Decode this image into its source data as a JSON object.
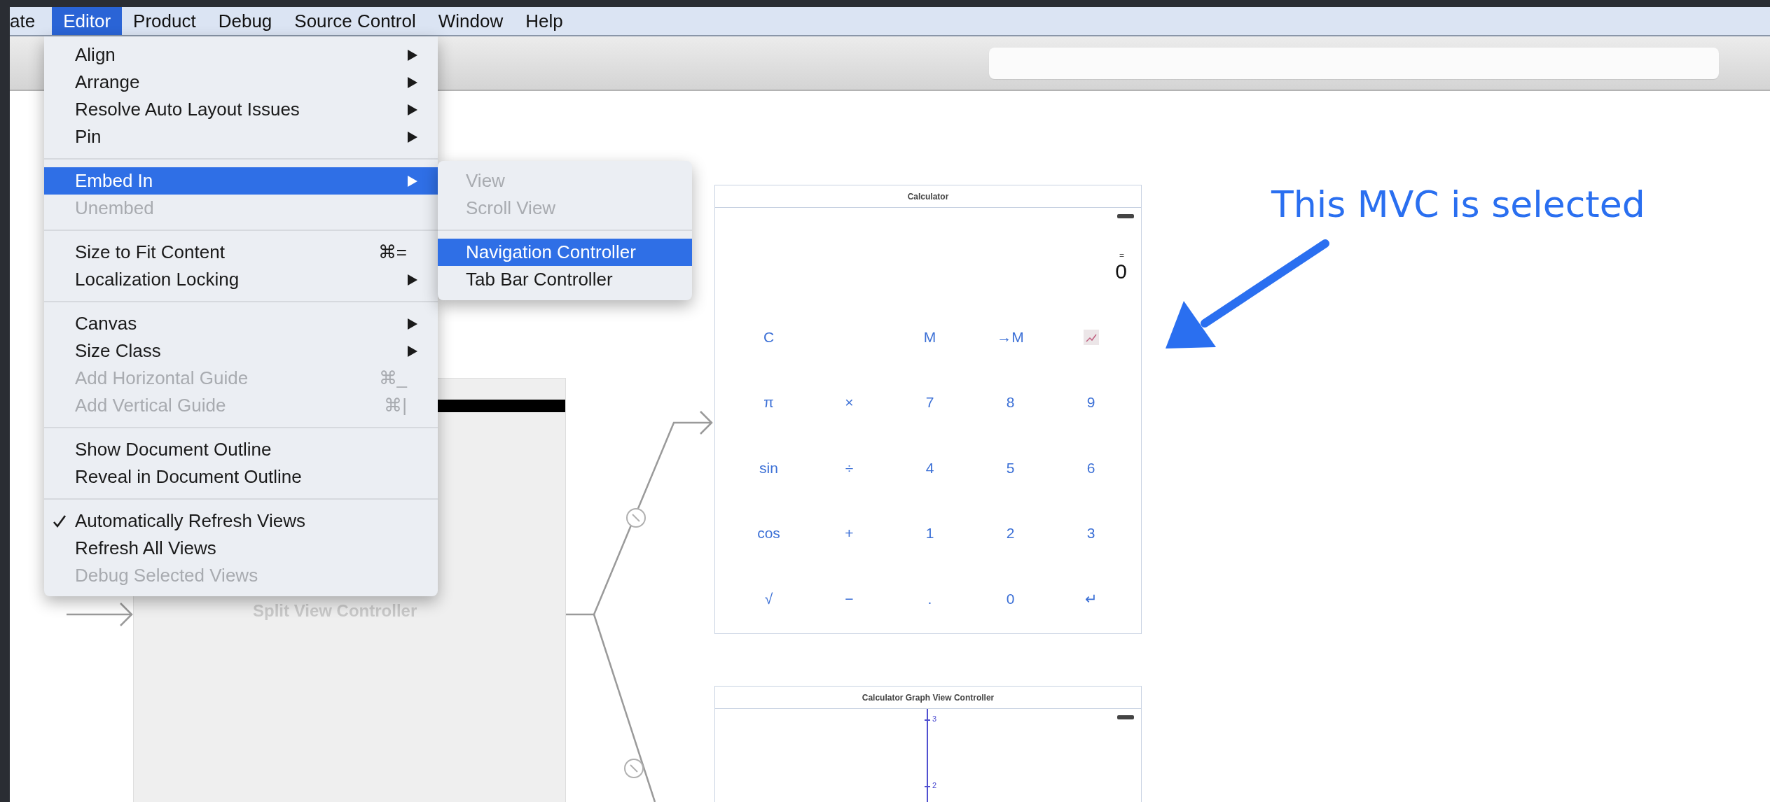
{
  "menu_bar": {
    "items": [
      {
        "label": "ate",
        "selected": false
      },
      {
        "label": "Editor",
        "selected": true
      },
      {
        "label": "Product",
        "selected": false
      },
      {
        "label": "Debug",
        "selected": false
      },
      {
        "label": "Source Control",
        "selected": false
      },
      {
        "label": "Window",
        "selected": false
      },
      {
        "label": "Help",
        "selected": false
      }
    ]
  },
  "editor_menu": {
    "sections": [
      {
        "items": [
          {
            "label": "Align",
            "submenu": true,
            "disabled": false,
            "selected": false,
            "checked": false
          },
          {
            "label": "Arrange",
            "submenu": true,
            "disabled": false,
            "selected": false,
            "checked": false
          },
          {
            "label": "Resolve Auto Layout Issues",
            "submenu": true,
            "disabled": false,
            "selected": false,
            "checked": false
          },
          {
            "label": "Pin",
            "submenu": true,
            "disabled": false,
            "selected": false,
            "checked": false
          }
        ]
      },
      {
        "items": [
          {
            "label": "Embed In",
            "submenu": true,
            "disabled": false,
            "selected": true,
            "checked": false
          },
          {
            "label": "Unembed",
            "submenu": false,
            "disabled": true,
            "selected": false,
            "checked": false
          }
        ]
      },
      {
        "items": [
          {
            "label": "Size to Fit Content",
            "shortcut": "⌘=",
            "submenu": false,
            "disabled": false,
            "selected": false,
            "checked": false
          },
          {
            "label": "Localization Locking",
            "submenu": true,
            "disabled": false,
            "selected": false,
            "checked": false
          }
        ]
      },
      {
        "items": [
          {
            "label": "Canvas",
            "submenu": true,
            "disabled": false,
            "selected": false,
            "checked": false
          },
          {
            "label": "Size Class",
            "submenu": true,
            "disabled": false,
            "selected": false,
            "checked": false
          },
          {
            "label": "Add Horizontal Guide",
            "shortcut": "⌘_",
            "submenu": false,
            "disabled": true,
            "selected": false,
            "checked": false
          },
          {
            "label": "Add Vertical Guide",
            "shortcut": "⌘|",
            "submenu": false,
            "disabled": true,
            "selected": false,
            "checked": false
          }
        ]
      },
      {
        "items": [
          {
            "label": "Show Document Outline",
            "submenu": false,
            "disabled": false,
            "selected": false,
            "checked": false
          },
          {
            "label": "Reveal in Document Outline",
            "submenu": false,
            "disabled": false,
            "selected": false,
            "checked": false
          }
        ]
      },
      {
        "items": [
          {
            "label": "Automatically Refresh Views",
            "submenu": false,
            "disabled": false,
            "selected": false,
            "checked": true
          },
          {
            "label": "Refresh All Views",
            "submenu": false,
            "disabled": false,
            "selected": false,
            "checked": false
          },
          {
            "label": "Debug Selected Views",
            "submenu": false,
            "disabled": true,
            "selected": false,
            "checked": false
          }
        ]
      }
    ]
  },
  "embed_in_submenu": {
    "sections": [
      {
        "items": [
          {
            "label": "View",
            "submenu": false,
            "disabled": true,
            "selected": false,
            "checked": false
          },
          {
            "label": "Scroll View",
            "submenu": false,
            "disabled": true,
            "selected": false,
            "checked": false
          }
        ]
      },
      {
        "items": [
          {
            "label": "Navigation Controller",
            "submenu": false,
            "disabled": false,
            "selected": true,
            "checked": false
          },
          {
            "label": "Tab Bar Controller",
            "submenu": false,
            "disabled": false,
            "selected": false,
            "checked": false
          }
        ]
      }
    ]
  },
  "canvas": {
    "split_view_controller": {
      "title": "Split View Controller"
    },
    "calculator_scene": {
      "title": "Calculator",
      "display": {
        "indicator": "=",
        "value": "0"
      },
      "keys": [
        [
          {
            "kind": "text",
            "label": "C"
          },
          {
            "kind": "blank"
          },
          {
            "kind": "text",
            "label": "M"
          },
          {
            "kind": "text",
            "label": "→M"
          },
          {
            "kind": "icon"
          }
        ],
        [
          {
            "kind": "text",
            "label": "π"
          },
          {
            "kind": "text",
            "label": "×"
          },
          {
            "kind": "text",
            "label": "7"
          },
          {
            "kind": "text",
            "label": "8"
          },
          {
            "kind": "text",
            "label": "9"
          }
        ],
        [
          {
            "kind": "text",
            "label": "sin"
          },
          {
            "kind": "text",
            "label": "÷"
          },
          {
            "kind": "text",
            "label": "4"
          },
          {
            "kind": "text",
            "label": "5"
          },
          {
            "kind": "text",
            "label": "6"
          }
        ],
        [
          {
            "kind": "text",
            "label": "cos"
          },
          {
            "kind": "text",
            "label": "+"
          },
          {
            "kind": "text",
            "label": "1"
          },
          {
            "kind": "text",
            "label": "2"
          },
          {
            "kind": "text",
            "label": "3"
          }
        ],
        [
          {
            "kind": "text",
            "label": "√"
          },
          {
            "kind": "text",
            "label": "−"
          },
          {
            "kind": "text",
            "label": "."
          },
          {
            "kind": "text",
            "label": "0"
          },
          {
            "kind": "text",
            "label": "↵"
          }
        ]
      ]
    },
    "graph_scene": {
      "title": "Calculator Graph View Controller",
      "axis_labels": [
        "3",
        "2"
      ]
    }
  },
  "annotation": {
    "text": "This MVC is selected"
  }
}
